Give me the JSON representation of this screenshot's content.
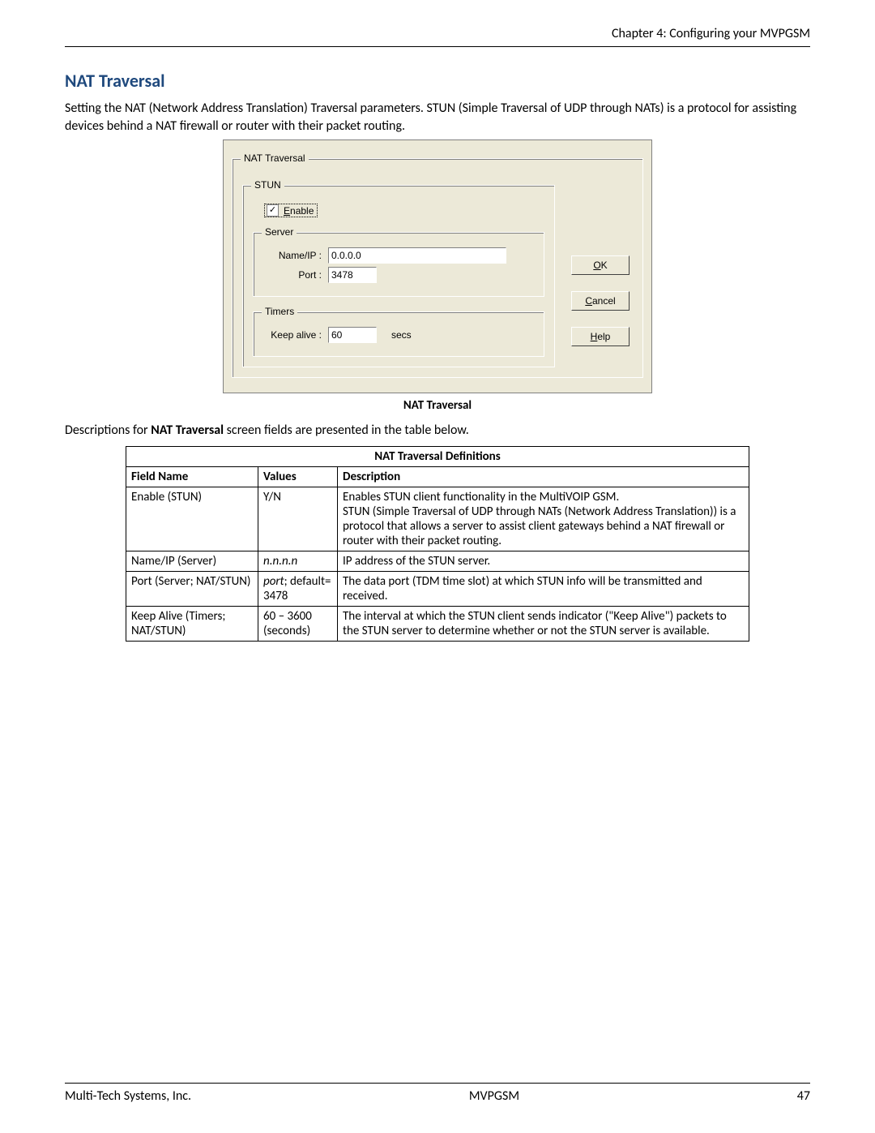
{
  "header": {
    "chapter": "Chapter 4: Configuring your MVPGSM"
  },
  "section": {
    "heading": "NAT Traversal",
    "intro": "Setting the NAT (Network Address Translation) Traversal parameters. STUN (Simple Traversal of UDP through NATs) is a protocol for assisting devices behind a NAT firewall or router with their packet routing."
  },
  "dialog": {
    "group_label": "NAT Traversal",
    "stun_label": "STUN",
    "enable_label": "Enable",
    "enable_checked": true,
    "server_label": "Server",
    "name_ip_label": "Name/IP :",
    "name_ip_value": "0.0.0.0",
    "port_label": "Port :",
    "port_value": "3478",
    "timers_label": "Timers",
    "keep_alive_label": "Keep alive :",
    "keep_alive_value": "60",
    "keep_alive_unit": "secs",
    "buttons": {
      "ok_pre": "O",
      "ok_rest": "K",
      "cancel_pre": "C",
      "cancel_rest": "ancel",
      "help_pre": "H",
      "help_rest": "elp"
    }
  },
  "caption": "NAT Traversal",
  "desc_line_pre": "Descriptions for ",
  "desc_line_bold": "NAT Traversal",
  "desc_line_post": " screen fields are presented in the table below.",
  "table": {
    "title": "NAT Traversal Definitions",
    "headers": {
      "field": "Field Name",
      "values": "Values",
      "description": "Description"
    },
    "rows": [
      {
        "field": "Enable (STUN)",
        "values": "Y/N",
        "values_italic": false,
        "description": "Enables STUN client functionality in the MultiVOIP GSM.\nSTUN (Simple Traversal of UDP through NATs (Network Address Translation)) is a protocol that allows a server to assist client gateways behind a NAT firewall or router with their packet routing."
      },
      {
        "field": "Name/IP (Server)",
        "values": "n.n.n.n",
        "values_italic": true,
        "description": "IP address of the STUN server."
      },
      {
        "field": "Port (Server; NAT/STUN)",
        "values": "port;\ndefault= 3478",
        "values_italic_first_word": "port",
        "description": "The data port (TDM time slot) at which STUN info will be transmitted and received."
      },
      {
        "field": "Keep Alive (Timers; NAT/STUN)",
        "values": "60 – 3600 (seconds)",
        "values_italic": false,
        "description": "The interval at which the STUN client sends indicator (\"Keep Alive\") packets to the STUN server to determine whether or not the STUN server is available."
      }
    ]
  },
  "footer": {
    "left": "Multi-Tech Systems, Inc.",
    "center": "MVPGSM",
    "right": "47"
  }
}
